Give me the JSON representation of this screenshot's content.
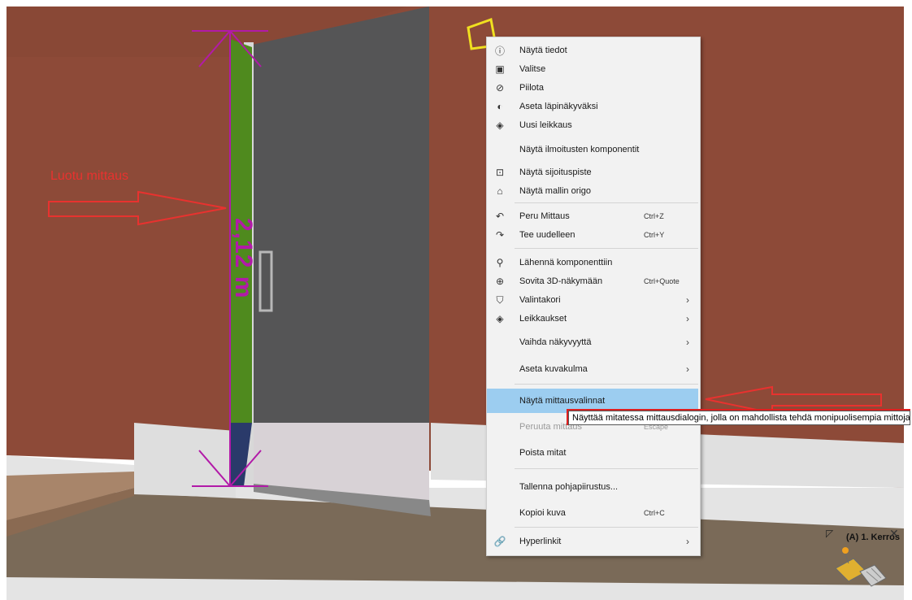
{
  "annotation": {
    "label": "Luotu mittaus",
    "dimension_value": "2,12 m"
  },
  "context_menu": {
    "items": [
      {
        "label": "Näytä tiedot",
        "icon": "info-icon"
      },
      {
        "label": "Valitse",
        "icon": "select-icon"
      },
      {
        "label": "Piilota",
        "icon": "hide-icon"
      },
      {
        "label": "Aseta läpinäkyväksi",
        "icon": "transparent-icon"
      },
      {
        "label": "Uusi leikkaus",
        "icon": "section-icon"
      },
      {
        "label": "Näytä ilmoitusten komponentit",
        "icon": ""
      },
      {
        "label": "Näytä sijoituspiste",
        "icon": "insertion-point-icon"
      },
      {
        "label": "Näytä mallin origo",
        "icon": "origin-icon"
      },
      {
        "label": "Peru Mittaus",
        "icon": "undo-icon",
        "shortcut": "Ctrl+Z"
      },
      {
        "label": "Tee uudelleen",
        "icon": "redo-icon",
        "shortcut": "Ctrl+Y"
      },
      {
        "label": "Lähennä komponenttiin",
        "icon": "zoom-icon"
      },
      {
        "label": "Sovita 3D-näkymään",
        "icon": "zoom-fit-icon",
        "shortcut": "Ctrl+Quote"
      },
      {
        "label": "Valintakori",
        "icon": "basket-icon",
        "submenu": true
      },
      {
        "label": "Leikkaukset",
        "icon": "sections-icon",
        "submenu": true
      },
      {
        "label": "Vaihda näkyvyyttä",
        "icon": "",
        "submenu": true
      },
      {
        "label": "Aseta kuvakulma",
        "icon": "",
        "submenu": true
      },
      {
        "label": "Näytä mittausvalinnat",
        "icon": "",
        "highlighted": true
      },
      {
        "label": "Peruuta mittaus",
        "icon": "",
        "shortcut": "Escape",
        "disabled": true
      },
      {
        "label": "Poista mitat",
        "icon": ""
      },
      {
        "label": "Tallenna pohjapiirustus...",
        "icon": ""
      },
      {
        "label": "Kopioi kuva",
        "icon": "",
        "shortcut": "Ctrl+C"
      },
      {
        "label": "Hyperlinkit",
        "icon": "link-icon",
        "submenu": true
      }
    ]
  },
  "tooltip": {
    "text": "Näyttää mitatessa mittausdialogin, jolla on mahdollista tehdä monipuolisempia mittoja."
  },
  "floor_widget": {
    "label": "(A) 1. Kerros"
  },
  "colors": {
    "wall": "#8d4a38",
    "measure_line": "#b21aa8",
    "annotation_red": "#e8322f",
    "highlight": "#9ccdf0"
  }
}
